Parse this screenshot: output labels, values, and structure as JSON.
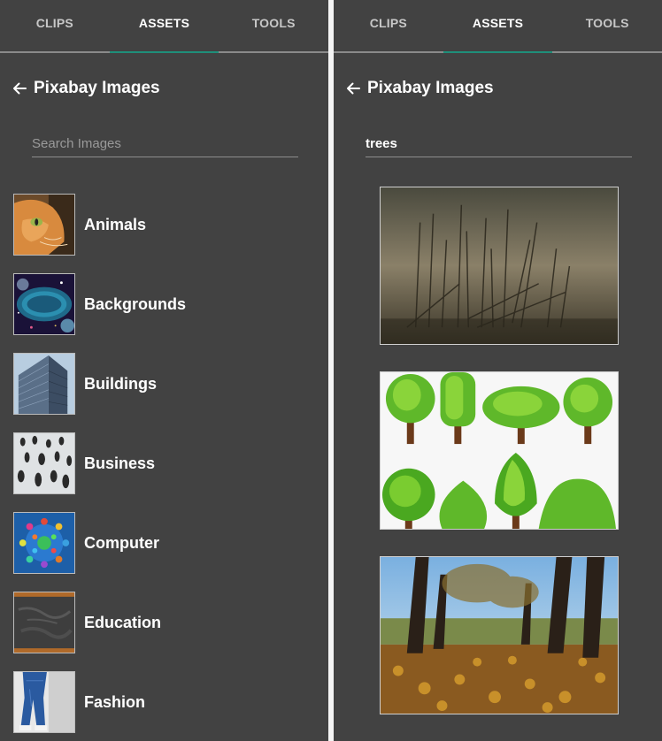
{
  "tabs": [
    {
      "label": "CLIPS"
    },
    {
      "label": "ASSETS"
    },
    {
      "label": "TOOLS"
    }
  ],
  "active_tab": "ASSETS",
  "header": {
    "title": "Pixabay Images"
  },
  "left_search": {
    "placeholder": "Search Images",
    "value": ""
  },
  "right_search": {
    "placeholder": "Search Images",
    "value": "trees"
  },
  "categories": [
    {
      "label": "Animals",
      "icon": "cat-photo"
    },
    {
      "label": "Backgrounds",
      "icon": "space-photo"
    },
    {
      "label": "Buildings",
      "icon": "skyscraper-photo"
    },
    {
      "label": "Business",
      "icon": "crowd-photo"
    },
    {
      "label": "Computer",
      "icon": "network-icons-photo"
    },
    {
      "label": "Education",
      "icon": "chalkboard-photo"
    },
    {
      "label": "Fashion",
      "icon": "jeans-photo"
    }
  ],
  "results": [
    {
      "name": "misty-dead-trees-photo"
    },
    {
      "name": "cartoon-trees-illustration"
    },
    {
      "name": "autumn-tree-lined-path-photo"
    }
  ],
  "colors": {
    "panel_bg": "#424242",
    "accent": "#1f8f7a",
    "text": "#ffffff",
    "muted": "#c7c7c7"
  }
}
